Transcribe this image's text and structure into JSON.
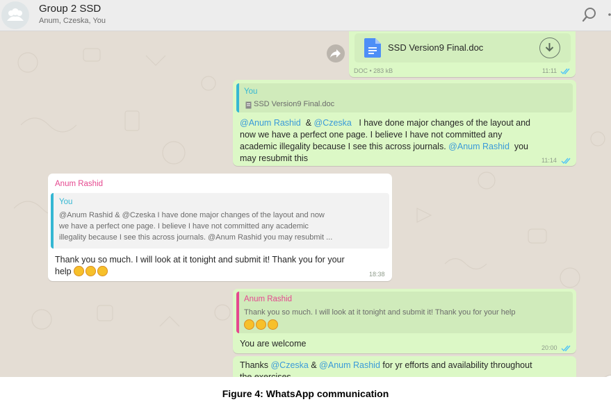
{
  "header": {
    "title": "Group 2 SSD",
    "members": "Anum, Czeska, You",
    "search_icon": "search-icon",
    "avatar_icon": "group-avatar-icon"
  },
  "messages": {
    "doc": {
      "file_name": "SSD Version9 Final.doc",
      "meta": "DOC • 283 kB",
      "time": "11:11",
      "file_icon": "document-icon",
      "download_icon": "download-icon",
      "forward_icon": "forward-icon"
    },
    "reply1": {
      "quote_author": "You",
      "quote_file": "SSD Version9 Final.doc",
      "mention1": "@Anum Rashid",
      "amp": "&",
      "mention2": "@Czeska",
      "text1": "I have done major changes of the layout and",
      "text2": "now we have a perfect one page. I believe I have not committed any",
      "text3": "academic illegality because I see this across journals.",
      "mention3": "@Anum Rashid",
      "text4": "you",
      "text5": "may resubmit this",
      "time": "11:14"
    },
    "incoming": {
      "sender": "Anum Rashid",
      "quote_author": "You",
      "quote_line1": "@Anum Rashid  & @Czeska   I have done major changes of the layout and now",
      "quote_line2": "we have a perfect one page. I believe I have not committed any academic",
      "quote_line3": "illegality because I see this across journals. @Anum Rashid  you may resubmit ...",
      "text1": "Thank you so much. I will look at it tonight and submit it! Thank you for your",
      "text2": "help",
      "time": "18:38"
    },
    "reply2": {
      "quote_author": "Anum Rashid",
      "quote_text": "Thank you so much. I will look at it tonight and submit it! Thank you for your help",
      "text": "You are welcome",
      "time": "20:00"
    },
    "thanks": {
      "text1": "Thanks",
      "mention1": "@Czeska",
      "amp": "&",
      "mention2": "@Anum Rashid",
      "text2": "for yr efforts and availability throughout",
      "text3": "the exercises"
    }
  },
  "colors": {
    "outgoing_bubble": "#dcf8c6",
    "incoming_bubble": "#ffffff",
    "mention": "#3a9ad9",
    "you_author": "#35b7d3",
    "anum_author": "#e5488f",
    "read_ticks": "#4fc3f7"
  },
  "caption": "Figure 4: WhatsApp communication"
}
